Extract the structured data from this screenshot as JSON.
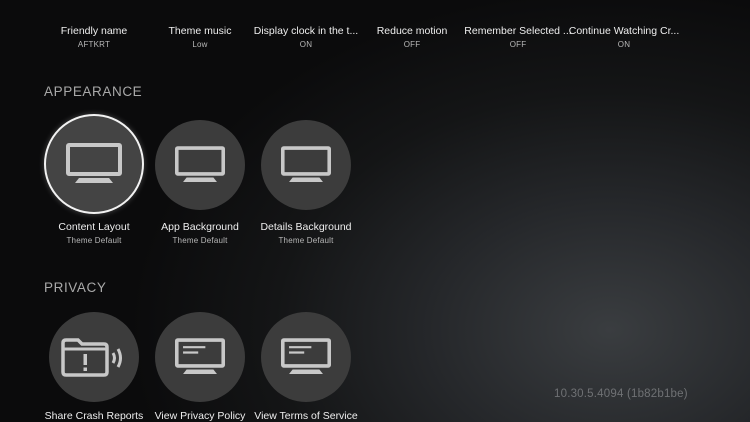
{
  "top_row": [
    {
      "label": "Friendly name",
      "value": "AFTKRT"
    },
    {
      "label": "Theme music",
      "value": "Low"
    },
    {
      "label": "Display clock in the t...",
      "value": "ON"
    },
    {
      "label": "Reduce motion",
      "value": "OFF"
    },
    {
      "label": "Remember Selected ...",
      "value": "OFF"
    },
    {
      "label": "Continue Watching Cr...",
      "value": "ON"
    }
  ],
  "appearance": {
    "header": "APPEARANCE",
    "items": [
      {
        "label": "Content Layout",
        "value": "Theme Default",
        "icon": "monitor-icon"
      },
      {
        "label": "App Background",
        "value": "Theme Default",
        "icon": "monitor-icon"
      },
      {
        "label": "Details Background",
        "value": "Theme Default",
        "icon": "monitor-icon"
      }
    ]
  },
  "privacy": {
    "header": "PRIVACY",
    "items": [
      {
        "label": "Share Crash Reports",
        "icon": "crash-report-icon"
      },
      {
        "label": "View Privacy Policy",
        "icon": "document-monitor-icon"
      },
      {
        "label": "View Terms of Service",
        "icon": "document-monitor-icon"
      }
    ]
  },
  "version": "10.30.5.4094 (1b82b1be)",
  "colors": {
    "circle": "#3c3c3c",
    "focus_ring": "#f2f2f2",
    "icon": "#c8c8c8",
    "section_header": "#a9a9a9"
  }
}
